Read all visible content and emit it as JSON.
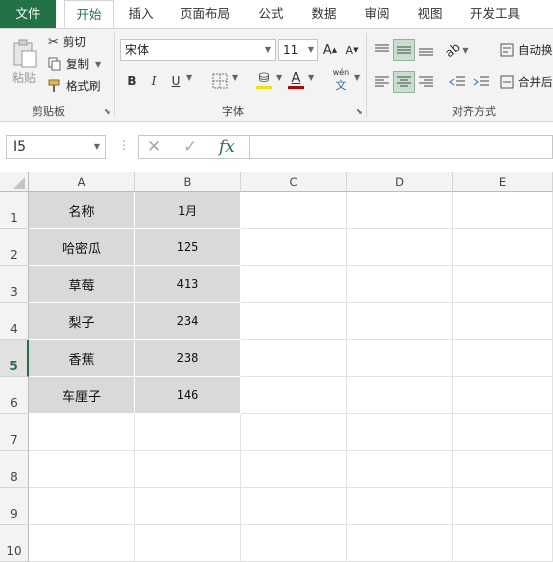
{
  "tabs": [
    "文件",
    "开始",
    "插入",
    "页面布局",
    "公式",
    "数据",
    "审阅",
    "视图",
    "开发工具"
  ],
  "ribbon": {
    "clipboard": {
      "paste": "粘贴",
      "cut": "剪切",
      "copy": "复制",
      "format_painter": "格式刷",
      "group_label": "剪贴板"
    },
    "font": {
      "font_name": "宋体",
      "font_size": "11",
      "bold": "B",
      "italic": "I",
      "underline": "U",
      "font_color": "A",
      "phonetic": "wén",
      "group_label": "字体"
    },
    "alignment": {
      "wrap_text": "自动换",
      "merge": "合并后",
      "group_label": "对齐方式"
    }
  },
  "formula_bar": {
    "name_box": "I5",
    "fx": "fx",
    "formula": ""
  },
  "columns": [
    "A",
    "B",
    "C",
    "D",
    "E"
  ],
  "rows": [
    "1",
    "2",
    "3",
    "4",
    "5",
    "6",
    "7",
    "8",
    "9",
    "10"
  ],
  "cells": [
    [
      "名称",
      "1月"
    ],
    [
      "哈密瓜",
      "125"
    ],
    [
      "草莓",
      "413"
    ],
    [
      "梨子",
      "234"
    ],
    [
      "香蕉",
      "238"
    ],
    [
      "车厘子",
      "146"
    ]
  ],
  "colors": {
    "accent": "#217346",
    "filled_cell": "#d9d9d9"
  },
  "selected_row": "5"
}
